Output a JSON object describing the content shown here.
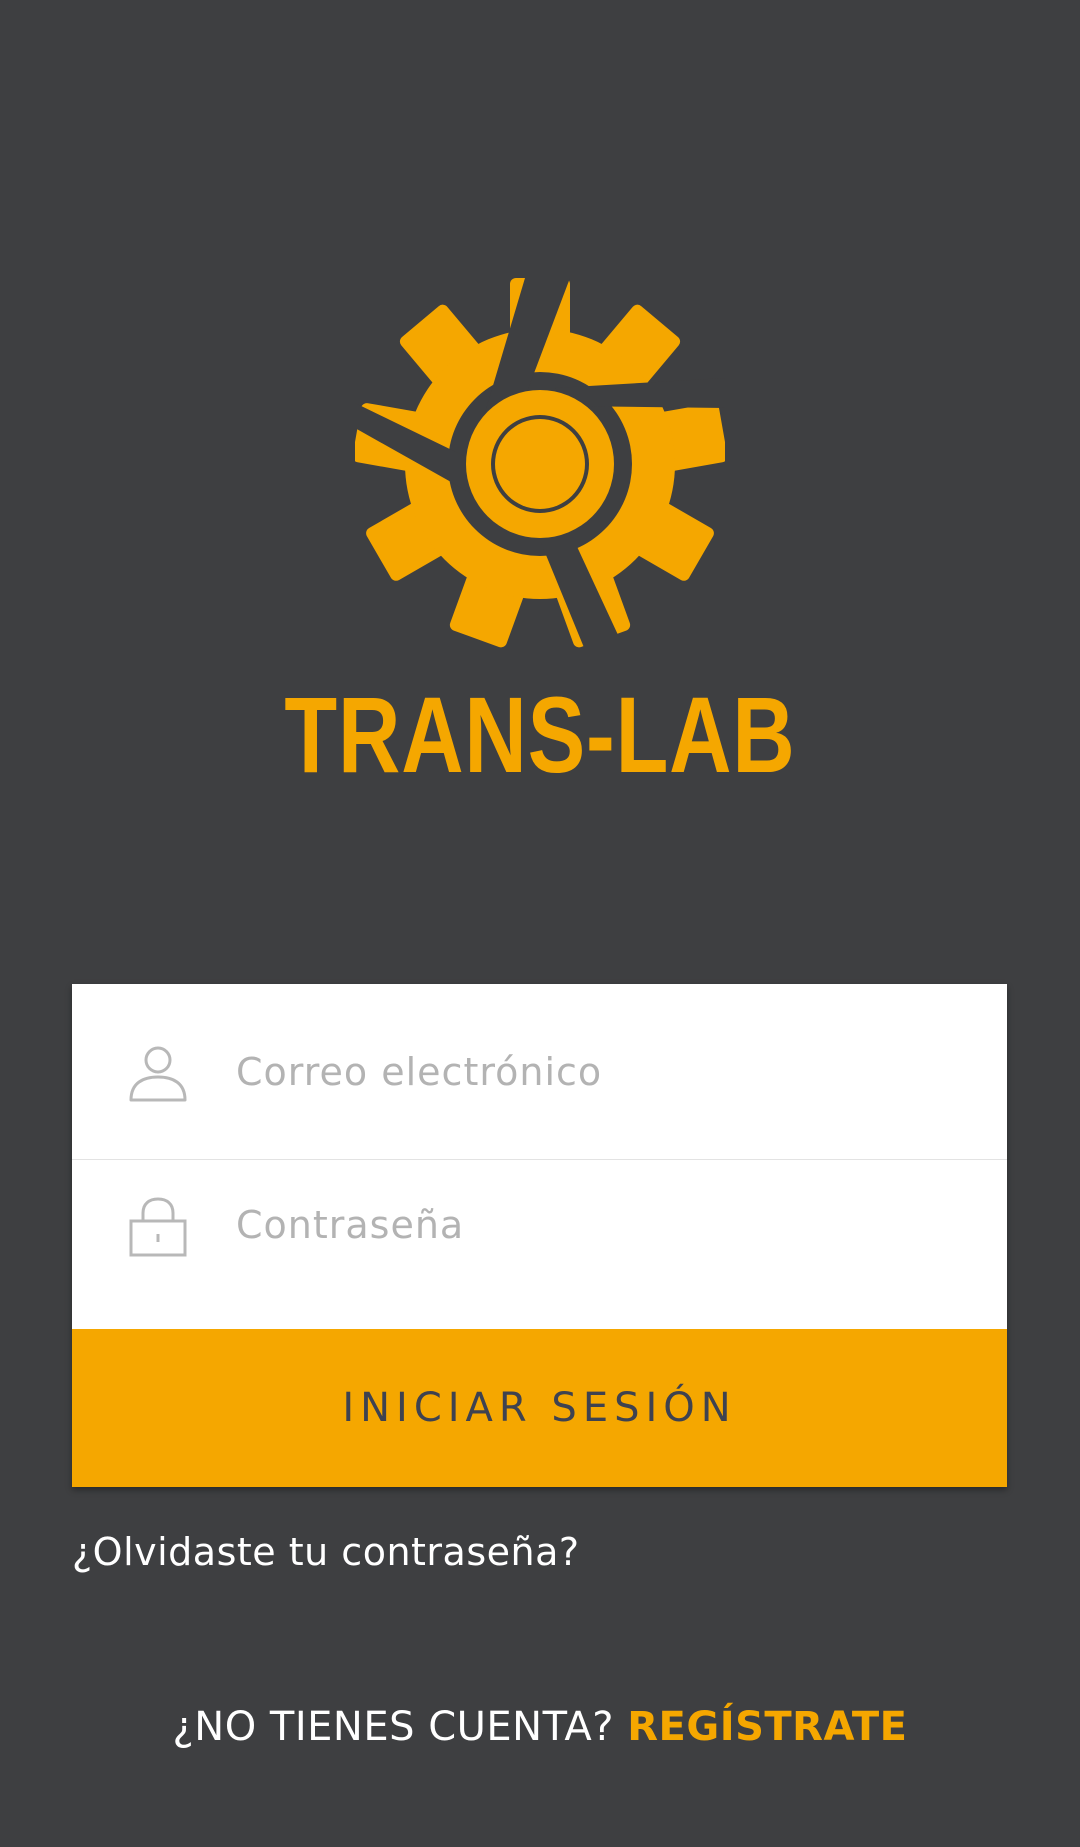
{
  "brand": {
    "name": "TRANS-LAB",
    "logo_icon": "gear-logo-icon",
    "accent_color": "#f5a700",
    "background_color": "#3e3f41"
  },
  "login_form": {
    "email_placeholder": "Correo electrónico",
    "email_icon": "user-icon",
    "password_placeholder": "Contraseña",
    "password_icon": "lock-icon",
    "submit_label": "INICIAR SESIÓN"
  },
  "forgot_password": {
    "label": "¿Olvidaste tu contraseña?"
  },
  "signup": {
    "prompt": "¿NO TIENES CUENTA?",
    "link_label": "REGÍSTRATE"
  }
}
